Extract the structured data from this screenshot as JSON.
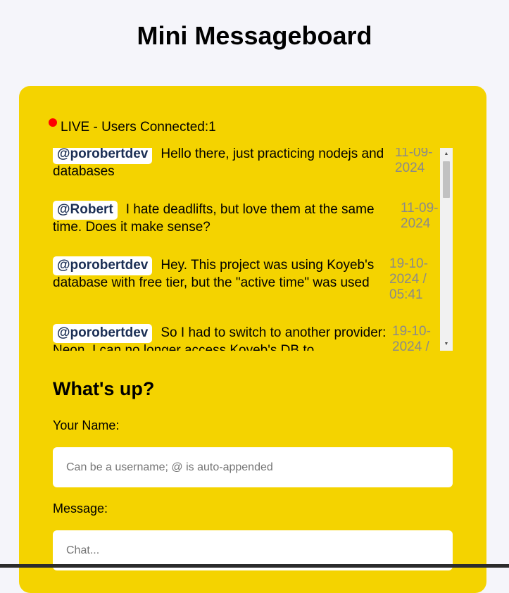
{
  "header": {
    "title": "Mini Messageboard"
  },
  "status": {
    "live_text": "LIVE - Users Connected:1",
    "dot_color": "#ff0000"
  },
  "messages": [
    {
      "user": "@porobertdev",
      "text": "Hello there, just practicing nodejs and databases",
      "date": "11-09-\n2024"
    },
    {
      "user": "@Robert",
      "text": "I hate deadlifts, but love them at the same time. Does it make sense?",
      "date": "11-09-\n2024"
    },
    {
      "user": "@porobertdev",
      "text": "Hey. This project was using Koyeb's database with free tier, but the \"active time\" was used",
      "date": "19-10-\n2024 /\n05:41"
    },
    {
      "user": "@porobertdev",
      "text": "So I had to switch to another provider: Neon. I can no longer access Koyeb's DB to",
      "date": "19-10-\n2024 /"
    }
  ],
  "form": {
    "heading": "What's up?",
    "name_label": "Your Name:",
    "name_placeholder": "Can be a username; @ is auto-appended",
    "name_value": "",
    "message_label": "Message:",
    "message_placeholder": "Chat...",
    "message_value": ""
  },
  "colors": {
    "page_background": "#f5f5fa",
    "board_background": "#f4d300",
    "handle_text": "#1a2e54",
    "date_text": "#8a8a8a"
  },
  "icons": {
    "scroll_up": "triangle-up-icon",
    "scroll_down": "triangle-down-icon",
    "live": "live-dot-icon"
  }
}
